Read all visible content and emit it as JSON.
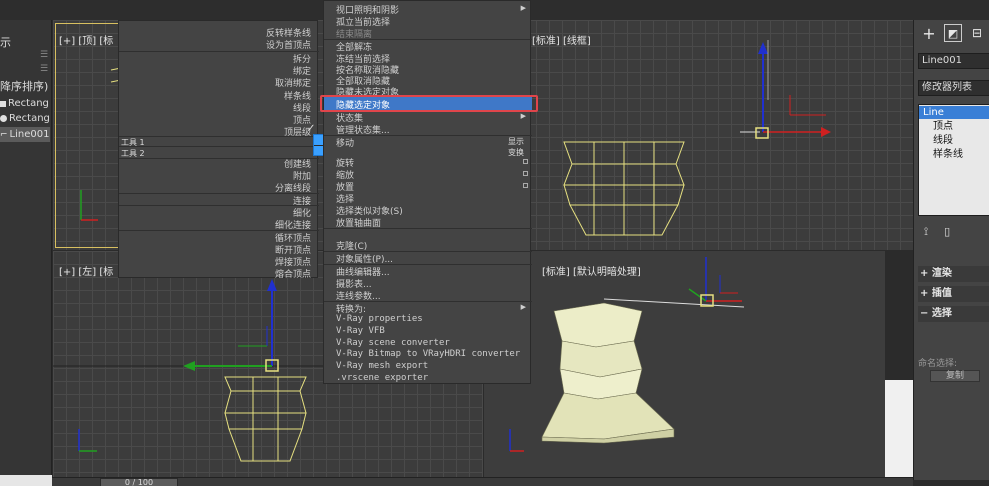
{
  "scene_explorer": {
    "header": "示",
    "sort_label": "降序排序)",
    "items": [
      {
        "label": "Rectang",
        "icon": "square-shape-icon"
      },
      {
        "label": "Rectang",
        "icon": "circle-shape-icon"
      },
      {
        "label": "Line001",
        "icon": "line-shape-icon",
        "selected": true
      }
    ]
  },
  "viewports": {
    "top_left": "[+] [顶] [标",
    "top_right": "[标准] [线框]",
    "bottom_left": "[+] [左] [标",
    "bottom_right": "[标准] [默认明暗处理]"
  },
  "quad_menu": {
    "top_items": [
      "反转样条线",
      "设为首顶点",
      "拆分",
      "绑定",
      "取消绑定",
      "样条线",
      "线段",
      "顶点",
      "顶层级"
    ],
    "tool1": "工具 1",
    "tool2": "工具 2",
    "show_label": "显示",
    "transform_label": "变换",
    "bottom_items": [
      "创建线",
      "附加",
      "分离线段",
      "连接",
      "细化",
      "细化连接",
      "循环顶点",
      "断开顶点",
      "焊接顶点",
      "熔合顶点"
    ]
  },
  "context_menu": {
    "items": [
      {
        "label": "视口照明和阴影",
        "arrow": true
      },
      {
        "label": "孤立当前选择"
      },
      {
        "label": "结束隔离",
        "dim": true
      },
      {
        "label": "全部解冻",
        "sep_before": true
      },
      {
        "label": "冻结当前选择"
      },
      {
        "label": "按名称取消隐藏"
      },
      {
        "label": "全部取消隐藏"
      },
      {
        "label": "隐藏未选定对象"
      },
      {
        "label": "隐藏选定对象",
        "highlighted": true
      },
      {
        "label": "状态集",
        "arrow": true
      },
      {
        "label": "管理状态集..."
      },
      {
        "label": "移动",
        "sep_before": true
      },
      {
        "label": "旋转"
      },
      {
        "label": "缩放"
      },
      {
        "label": "放置"
      },
      {
        "label": "选择"
      },
      {
        "label": "选择类似对象(S)"
      },
      {
        "label": "放置轴曲面"
      },
      {
        "label": "克隆(C)"
      },
      {
        "label": "对象属性(P)..."
      },
      {
        "label": "曲线编辑器..."
      },
      {
        "label": "摄影表..."
      },
      {
        "label": "连线参数..."
      },
      {
        "label": "转换为:",
        "arrow": true,
        "sep_before": true
      },
      {
        "label": "V-Ray properties"
      },
      {
        "label": "V-Ray VFB"
      },
      {
        "label": "V-Ray scene converter"
      },
      {
        "label": "V-Ray Bitmap to VRayHDRI converter"
      },
      {
        "label": "V-Ray mesh export"
      },
      {
        "label": ".vrscene exporter"
      }
    ]
  },
  "command_panel": {
    "object_name": "Line001",
    "modifier_list": "修改器列表",
    "stack": [
      "Line",
      "顶点",
      "线段",
      "样条线"
    ],
    "rollouts": [
      "渲染",
      "插值",
      "选择"
    ],
    "named_selection": "命名选择:",
    "copy_button": "复制"
  },
  "timeline": {
    "frame": "0 / 100"
  },
  "colors": {
    "highlight": "#3f78c8",
    "annotation_box": "#e0454b",
    "axis_red": "#d02020",
    "axis_green": "#20a020",
    "axis_blue": "#2030d0",
    "wire_yellow": "#e6e080",
    "solid_cream": "#ecedc8"
  }
}
